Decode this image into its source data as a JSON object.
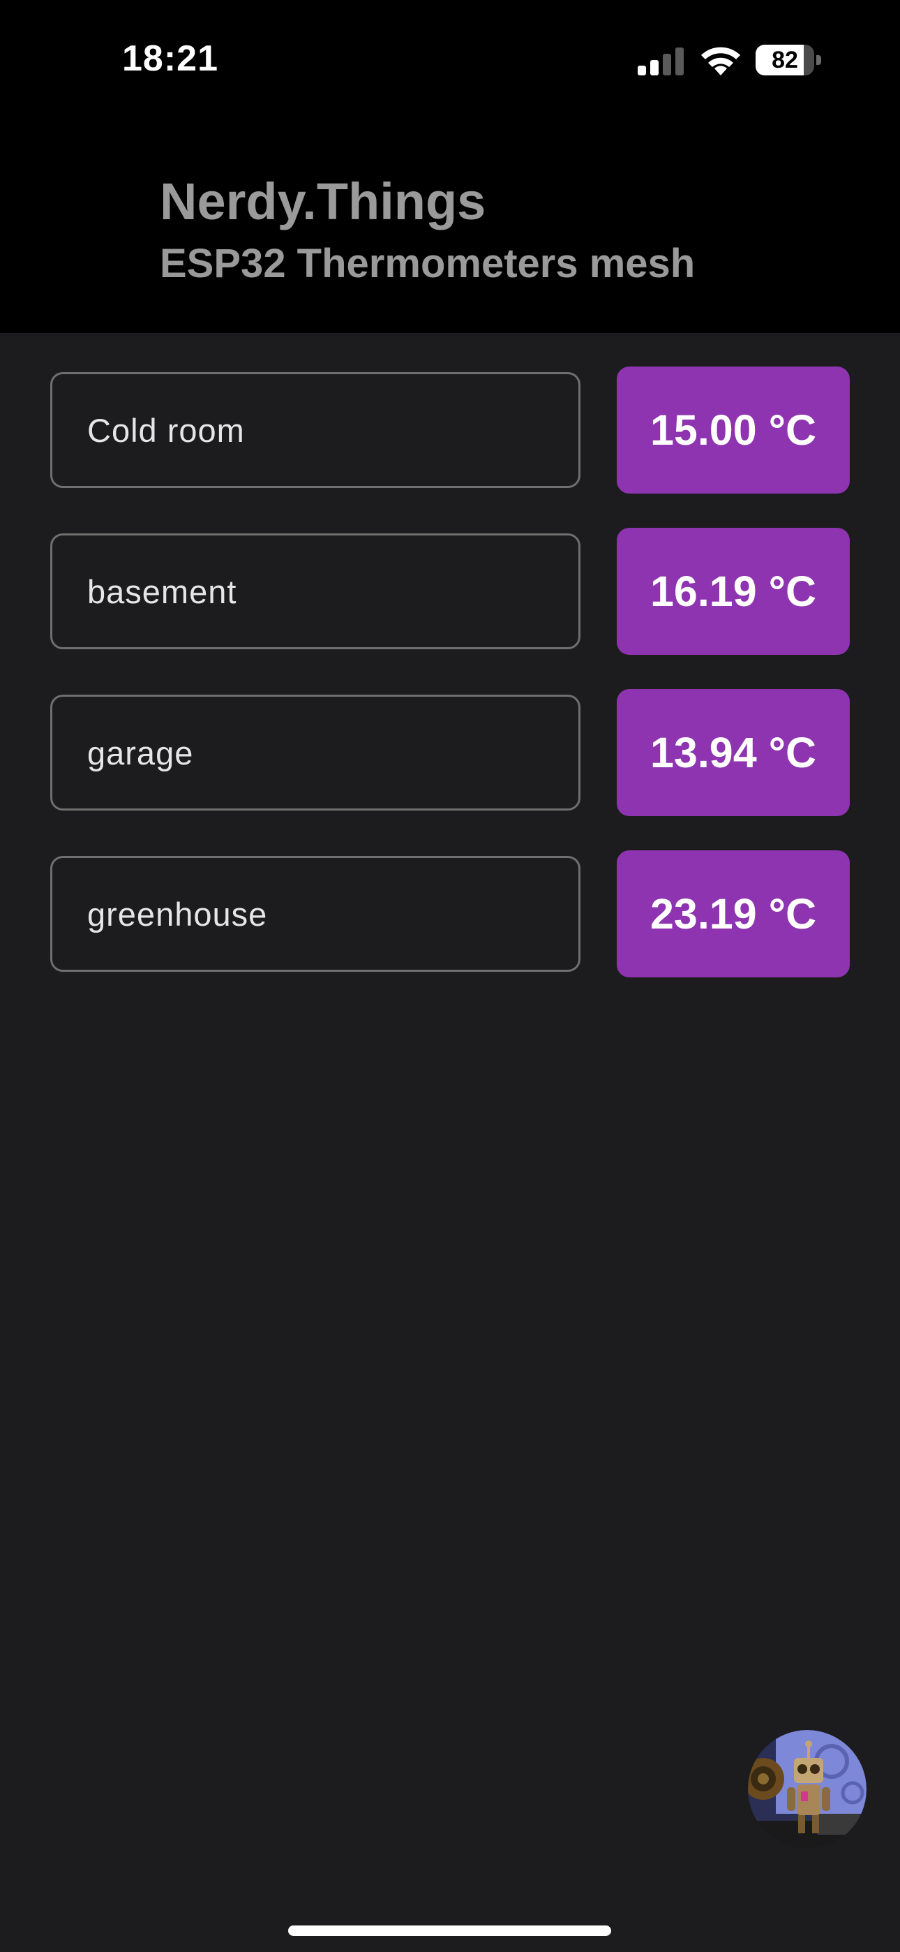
{
  "status_bar": {
    "time": "18:21",
    "battery_level": "82",
    "battery_fraction": 0.82,
    "signal_icon": "cellular-signal-icon",
    "wifi_icon": "wifi-icon"
  },
  "header": {
    "title": "Nerdy.Things",
    "subtitle": "ESP32 Thermometers mesh"
  },
  "colors": {
    "header_background": "#000000",
    "page_background": "#1c1c1e",
    "title_text": "#9a9a9a",
    "badge_background": "#8e34b0",
    "field_border": "#6f6f6f"
  },
  "sensors": [
    {
      "name": "Cold room",
      "temperature": "15.00 °C"
    },
    {
      "name": "basement",
      "temperature": "16.19 °C"
    },
    {
      "name": "garage",
      "temperature": "13.94 °C"
    },
    {
      "name": "greenhouse",
      "temperature": "23.19 °C"
    }
  ],
  "avatar": {
    "icon": "robot-avatar-icon"
  }
}
